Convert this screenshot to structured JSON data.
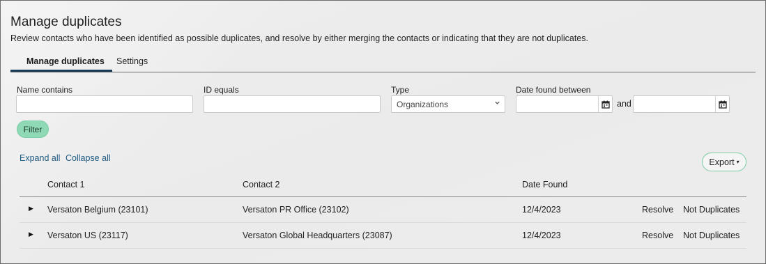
{
  "page": {
    "title": "Manage duplicates",
    "description": "Review contacts who have been identified as possible duplicates, and resolve by either merging the contacts or indicating that they are not duplicates."
  },
  "tabs": [
    {
      "label": "Manage duplicates",
      "active": true
    },
    {
      "label": "Settings",
      "active": false
    }
  ],
  "filters": {
    "name_label": "Name contains",
    "name_value": "",
    "id_label": "ID equals",
    "id_value": "",
    "type_label": "Type",
    "type_selected": "Organizations",
    "date_label": "Date found between",
    "date_from": "",
    "date_and": "and",
    "date_to": "",
    "filter_button": "Filter"
  },
  "actions": {
    "expand_all": "Expand all",
    "collapse_all": "Collapse all",
    "export": "Export"
  },
  "table": {
    "headers": [
      "Contact 1",
      "Contact 2",
      "Date Found"
    ],
    "rows": [
      {
        "contact1": "Versaton Belgium (23101)",
        "contact2": "Versaton PR Office (23102)",
        "date_found": "12/4/2023",
        "resolve": "Resolve",
        "not_duplicates": "Not Duplicates"
      },
      {
        "contact1": "Versaton US (23117)",
        "contact2": "Versaton Global Headquarters (23087)",
        "date_found": "12/4/2023",
        "resolve": "Resolve",
        "not_duplicates": "Not Duplicates"
      }
    ]
  },
  "icons": {
    "calendar": "calendar-icon",
    "select_chevron": "chevron-down-icon",
    "export_caret": "caret-down-icon",
    "row_expand": "triangle-right-icon"
  },
  "colors": {
    "link": "#1e5a82",
    "primary_button": "#8fd9b6",
    "tab_underline": "#163b57"
  }
}
